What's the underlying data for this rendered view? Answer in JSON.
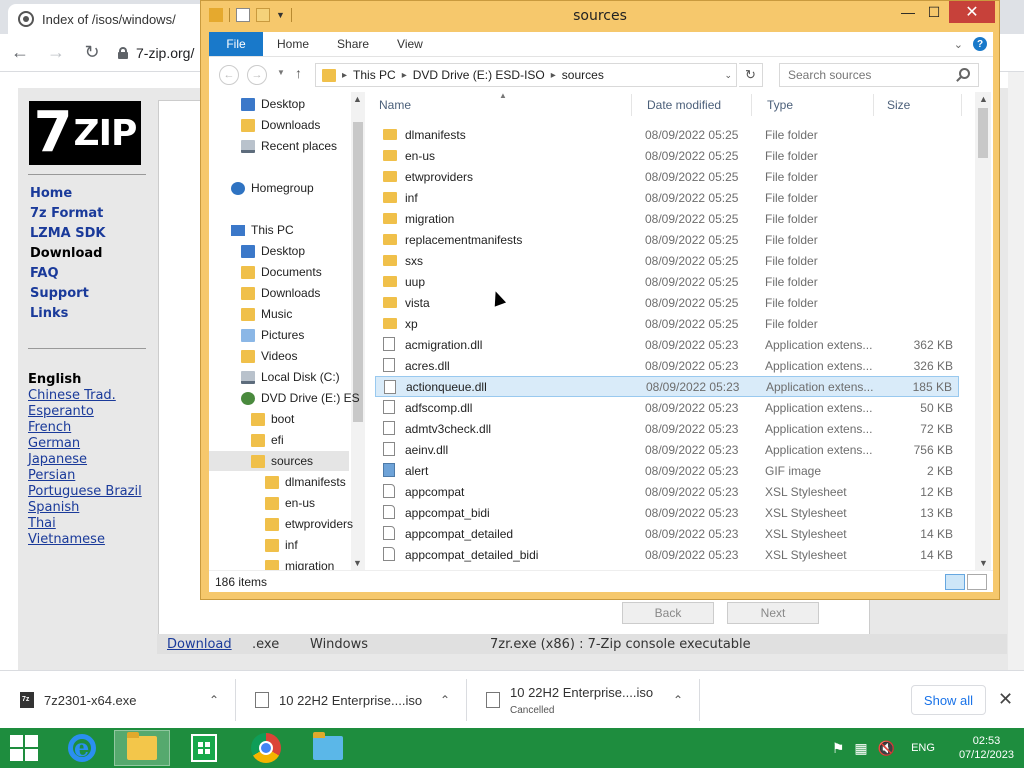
{
  "browser": {
    "tab_title": "Index of /isos/windows/",
    "url": "7-zip.org/",
    "logo_text": "ZIP",
    "logo_digit": "7",
    "nav": [
      {
        "label": "Home",
        "current": false
      },
      {
        "label": "7z Format",
        "current": false
      },
      {
        "label": "LZMA SDK",
        "current": false
      },
      {
        "label": "Download",
        "current": true
      },
      {
        "label": "FAQ",
        "current": false
      },
      {
        "label": "Support",
        "current": false
      },
      {
        "label": "Links",
        "current": false
      }
    ],
    "language_title": "English",
    "languages": [
      "Chinese Trad.",
      "Esperanto",
      "French",
      "German",
      "Japanese",
      "Persian",
      "Portuguese Brazil",
      "Spanish",
      "Thai",
      "Vietnamese"
    ],
    "bottom_row": {
      "link": "Download",
      "ext": ".exe",
      "os": "Windows",
      "desc": "7zr.exe (x86) : 7-Zip console executable"
    },
    "ghost_buttons": [
      "Back",
      "Next"
    ]
  },
  "downloads": {
    "items": [
      {
        "name": "7z2301-x64.exe",
        "status": ""
      },
      {
        "name": "10 22H2 Enterprise....iso",
        "status": ""
      },
      {
        "name": "10 22H2 Enterprise....iso",
        "status": "Cancelled"
      }
    ],
    "show_all": "Show all"
  },
  "taskbar": {
    "language": "ENG",
    "time": "02:53",
    "date": "07/12/2023"
  },
  "explorer": {
    "title": "sources",
    "ribbon_tabs": [
      "File",
      "Home",
      "Share",
      "View"
    ],
    "breadcrumb": [
      "This PC",
      "DVD Drive (E:) ESD-ISO",
      "sources"
    ],
    "search_placeholder": "Search sources",
    "columns": {
      "name": "Name",
      "date": "Date modified",
      "type": "Type",
      "size": "Size"
    },
    "nav_items": [
      {
        "label": "Desktop",
        "icon": "desktop-icon",
        "indent": 1,
        "selected": false
      },
      {
        "label": "Downloads",
        "icon": "folder-icon",
        "indent": 1,
        "selected": false
      },
      {
        "label": "Recent places",
        "icon": "recent-places-icon",
        "indent": 1,
        "selected": false
      },
      {
        "label": "Homegroup",
        "icon": "homegroup-icon",
        "indent": 0,
        "selected": false
      },
      {
        "label": "This PC",
        "icon": "computer-icon",
        "indent": 0,
        "selected": false
      },
      {
        "label": "Desktop",
        "icon": "desktop-icon",
        "indent": 1,
        "selected": false
      },
      {
        "label": "Documents",
        "icon": "folder-icon",
        "indent": 1,
        "selected": false
      },
      {
        "label": "Downloads",
        "icon": "folder-icon",
        "indent": 1,
        "selected": false
      },
      {
        "label": "Music",
        "icon": "music-folder-icon",
        "indent": 1,
        "selected": false
      },
      {
        "label": "Pictures",
        "icon": "pictures-folder-icon",
        "indent": 1,
        "selected": false
      },
      {
        "label": "Videos",
        "icon": "folder-icon",
        "indent": 1,
        "selected": false
      },
      {
        "label": "Local Disk (C:)",
        "icon": "drive-icon",
        "indent": 1,
        "selected": false
      },
      {
        "label": "DVD Drive (E:) ES",
        "icon": "dvd-drive-icon",
        "indent": 1,
        "selected": false
      },
      {
        "label": "boot",
        "icon": "folder-icon",
        "indent": 2,
        "selected": false
      },
      {
        "label": "efi",
        "icon": "folder-icon",
        "indent": 2,
        "selected": false
      },
      {
        "label": "sources",
        "icon": "folder-icon",
        "indent": 2,
        "selected": true
      },
      {
        "label": "dlmanifests",
        "icon": "folder-icon",
        "indent": 3,
        "selected": false
      },
      {
        "label": "en-us",
        "icon": "folder-icon",
        "indent": 3,
        "selected": false
      },
      {
        "label": "etwproviders",
        "icon": "folder-icon",
        "indent": 3,
        "selected": false
      },
      {
        "label": "inf",
        "icon": "folder-icon",
        "indent": 3,
        "selected": false
      },
      {
        "label": "migration",
        "icon": "folder-icon",
        "indent": 3,
        "selected": false
      }
    ],
    "files": [
      {
        "name": "dlmanifests",
        "date": "08/09/2022 05:25",
        "type": "File folder",
        "size": "",
        "kind": "folder",
        "selected": false
      },
      {
        "name": "en-us",
        "date": "08/09/2022 05:25",
        "type": "File folder",
        "size": "",
        "kind": "folder",
        "selected": false
      },
      {
        "name": "etwproviders",
        "date": "08/09/2022 05:25",
        "type": "File folder",
        "size": "",
        "kind": "folder",
        "selected": false
      },
      {
        "name": "inf",
        "date": "08/09/2022 05:25",
        "type": "File folder",
        "size": "",
        "kind": "folder",
        "selected": false
      },
      {
        "name": "migration",
        "date": "08/09/2022 05:25",
        "type": "File folder",
        "size": "",
        "kind": "folder",
        "selected": false
      },
      {
        "name": "replacementmanifests",
        "date": "08/09/2022 05:25",
        "type": "File folder",
        "size": "",
        "kind": "folder",
        "selected": false
      },
      {
        "name": "sxs",
        "date": "08/09/2022 05:25",
        "type": "File folder",
        "size": "",
        "kind": "folder",
        "selected": false
      },
      {
        "name": "uup",
        "date": "08/09/2022 05:25",
        "type": "File folder",
        "size": "",
        "kind": "folder",
        "selected": false
      },
      {
        "name": "vista",
        "date": "08/09/2022 05:25",
        "type": "File folder",
        "size": "",
        "kind": "folder",
        "selected": false
      },
      {
        "name": "xp",
        "date": "08/09/2022 05:25",
        "type": "File folder",
        "size": "",
        "kind": "folder",
        "selected": false
      },
      {
        "name": "acmigration.dll",
        "date": "08/09/2022 05:23",
        "type": "Application extens...",
        "size": "362 KB",
        "kind": "dll",
        "selected": false
      },
      {
        "name": "acres.dll",
        "date": "08/09/2022 05:23",
        "type": "Application extens...",
        "size": "326 KB",
        "kind": "dll",
        "selected": false
      },
      {
        "name": "actionqueue.dll",
        "date": "08/09/2022 05:23",
        "type": "Application extens...",
        "size": "185 KB",
        "kind": "dll",
        "selected": true
      },
      {
        "name": "adfscomp.dll",
        "date": "08/09/2022 05:23",
        "type": "Application extens...",
        "size": "50 KB",
        "kind": "dll",
        "selected": false
      },
      {
        "name": "admtv3check.dll",
        "date": "08/09/2022 05:23",
        "type": "Application extens...",
        "size": "72 KB",
        "kind": "dll",
        "selected": false
      },
      {
        "name": "aeinv.dll",
        "date": "08/09/2022 05:23",
        "type": "Application extens...",
        "size": "756 KB",
        "kind": "dll",
        "selected": false
      },
      {
        "name": "alert",
        "date": "08/09/2022 05:23",
        "type": "GIF image",
        "size": "2 KB",
        "kind": "gif",
        "selected": false
      },
      {
        "name": "appcompat",
        "date": "08/09/2022 05:23",
        "type": "XSL Stylesheet",
        "size": "12 KB",
        "kind": "xsl",
        "selected": false
      },
      {
        "name": "appcompat_bidi",
        "date": "08/09/2022 05:23",
        "type": "XSL Stylesheet",
        "size": "13 KB",
        "kind": "xsl",
        "selected": false
      },
      {
        "name": "appcompat_detailed",
        "date": "08/09/2022 05:23",
        "type": "XSL Stylesheet",
        "size": "14 KB",
        "kind": "xsl",
        "selected": false
      },
      {
        "name": "appcompat_detailed_bidi",
        "date": "08/09/2022 05:23",
        "type": "XSL Stylesheet",
        "size": "14 KB",
        "kind": "xsl",
        "selected": false
      }
    ],
    "item_count": "186 items"
  }
}
